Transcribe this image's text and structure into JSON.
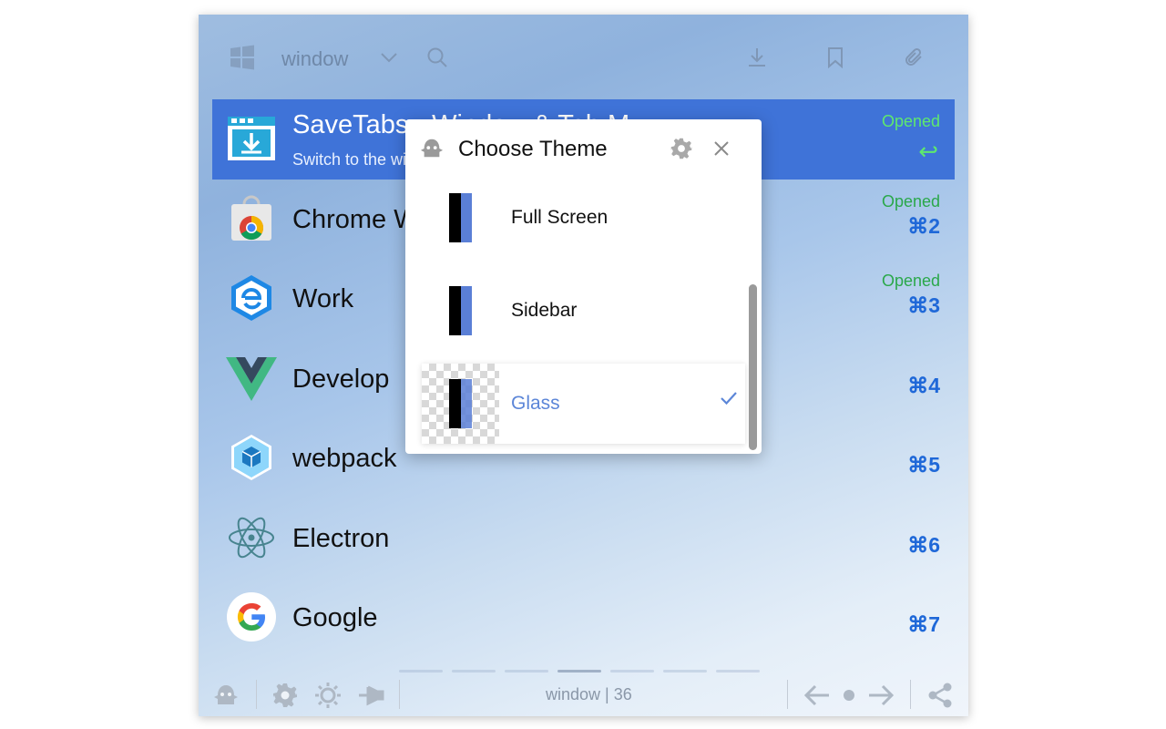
{
  "topbar": {
    "window_label": "window",
    "icons": [
      "windows-icon",
      "chevron-down-icon",
      "search-icon",
      "download-icon",
      "bookmark-icon",
      "paperclip-icon"
    ]
  },
  "list": {
    "items": [
      {
        "title": "SaveTabs - Window & Tab M",
        "subtitle": "Switch to the window",
        "status": "Opened",
        "shortcut": "↩",
        "icon": "savetabs-icon"
      },
      {
        "title": "Chrome W",
        "status": "Opened",
        "shortcut": "⌘2",
        "icon": "chrome-store-icon"
      },
      {
        "title": "Work",
        "status": "Opened",
        "shortcut": "⌘3",
        "icon": "edge-icon"
      },
      {
        "title": "Develop",
        "status": "",
        "shortcut": "⌘4",
        "icon": "vue-icon"
      },
      {
        "title": "webpack",
        "status": "",
        "shortcut": "⌘5",
        "icon": "webpack-icon"
      },
      {
        "title": "Electron",
        "status": "",
        "shortcut": "⌘6",
        "icon": "electron-icon"
      },
      {
        "title": "Google",
        "status": "",
        "shortcut": "⌘7",
        "icon": "google-icon"
      }
    ]
  },
  "footer": {
    "text": "window | 36",
    "icons": [
      "ghost-icon",
      "gear-icon",
      "sun-icon",
      "pin-icon",
      "arrow-left-icon",
      "dot-icon",
      "arrow-right-icon",
      "share-icon"
    ]
  },
  "popup": {
    "title": "Choose Theme",
    "themes": [
      {
        "label": "Full Screen",
        "selected": false
      },
      {
        "label": "Sidebar",
        "selected": false
      },
      {
        "label": "Glass",
        "selected": true
      }
    ]
  },
  "colors": {
    "accent": "#3f73d8",
    "opened": "#2aa84a",
    "shortcut": "#1f68d8",
    "glass_selected": "#5c86d8"
  }
}
